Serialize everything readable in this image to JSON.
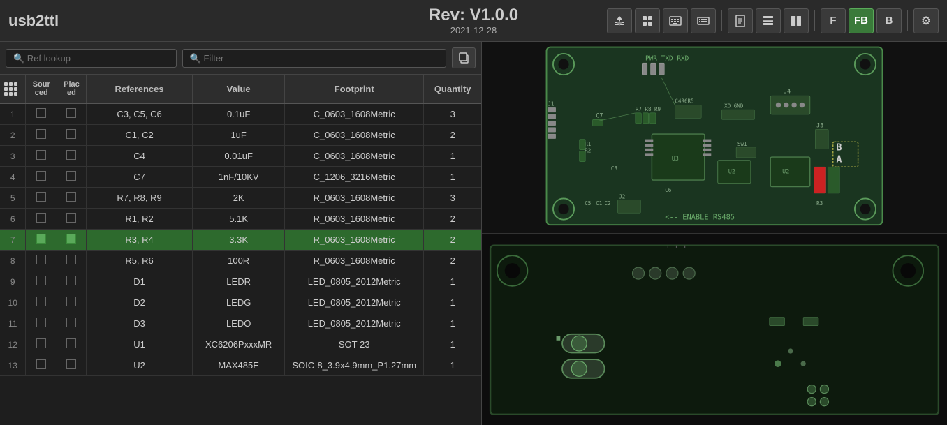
{
  "app": {
    "title": "usb2ttl",
    "revision": "Rev: V1.0.0",
    "date": "2021-12-28"
  },
  "toolbar": {
    "buttons": [
      {
        "id": "import",
        "label": "⬆",
        "active": false
      },
      {
        "id": "grid",
        "label": "⊞",
        "active": false
      },
      {
        "id": "keyboard1",
        "label": "⌨",
        "active": false
      },
      {
        "id": "keyboard2",
        "label": "⌨",
        "active": false
      },
      {
        "id": "doc",
        "label": "📄",
        "active": false
      },
      {
        "id": "list1",
        "label": "☰",
        "active": false
      },
      {
        "id": "list2",
        "label": "☰",
        "active": false
      },
      {
        "id": "F",
        "label": "F",
        "active": false
      },
      {
        "id": "FB",
        "label": "FB",
        "active": true
      },
      {
        "id": "B",
        "label": "B",
        "active": false
      },
      {
        "id": "gear",
        "label": "⚙",
        "active": false
      }
    ]
  },
  "search": {
    "ref_placeholder": "🔍 Ref lookup",
    "filter_placeholder": "🔍 Filter"
  },
  "table": {
    "headers": [
      "",
      "Sourced",
      "Placed",
      "References",
      "Value",
      "Footprint",
      "Quantity"
    ],
    "rows": [
      {
        "num": 1,
        "sourced": false,
        "placed": false,
        "refs": "C3, C5, C6",
        "value": "0.1uF",
        "footprint": "C_0603_1608Metric",
        "qty": 3,
        "highlight": false
      },
      {
        "num": 2,
        "sourced": false,
        "placed": false,
        "refs": "C1, C2",
        "value": "1uF",
        "footprint": "C_0603_1608Metric",
        "qty": 2,
        "highlight": false
      },
      {
        "num": 3,
        "sourced": false,
        "placed": false,
        "refs": "C4",
        "value": "0.01uF",
        "footprint": "C_0603_1608Metric",
        "qty": 1,
        "highlight": false
      },
      {
        "num": 4,
        "sourced": false,
        "placed": false,
        "refs": "C7",
        "value": "1nF/10KV",
        "footprint": "C_1206_3216Metric",
        "qty": 1,
        "highlight": false
      },
      {
        "num": 5,
        "sourced": false,
        "placed": false,
        "refs": "R7, R8, R9",
        "value": "2K",
        "footprint": "R_0603_1608Metric",
        "qty": 3,
        "highlight": false
      },
      {
        "num": 6,
        "sourced": false,
        "placed": false,
        "refs": "R1, R2",
        "value": "5.1K",
        "footprint": "R_0603_1608Metric",
        "qty": 2,
        "highlight": false
      },
      {
        "num": 7,
        "sourced": true,
        "placed": true,
        "refs": "R3, R4",
        "value": "3.3K",
        "footprint": "R_0603_1608Metric",
        "qty": 2,
        "highlight": true
      },
      {
        "num": 8,
        "sourced": false,
        "placed": false,
        "refs": "R5, R6",
        "value": "100R",
        "footprint": "R_0603_1608Metric",
        "qty": 2,
        "highlight": false
      },
      {
        "num": 9,
        "sourced": false,
        "placed": false,
        "refs": "D1",
        "value": "LEDR",
        "footprint": "LED_0805_2012Metric",
        "qty": 1,
        "highlight": false
      },
      {
        "num": 10,
        "sourced": false,
        "placed": false,
        "refs": "D2",
        "value": "LEDG",
        "footprint": "LED_0805_2012Metric",
        "qty": 1,
        "highlight": false
      },
      {
        "num": 11,
        "sourced": false,
        "placed": false,
        "refs": "D3",
        "value": "LEDO",
        "footprint": "LED_0805_2012Metric",
        "qty": 1,
        "highlight": false
      },
      {
        "num": 12,
        "sourced": false,
        "placed": false,
        "refs": "U1",
        "value": "XC6206PxxxMR",
        "footprint": "SOT-23",
        "qty": 1,
        "highlight": false
      },
      {
        "num": 13,
        "sourced": false,
        "placed": false,
        "refs": "U2",
        "value": "MAX485E",
        "footprint": "SOIC-8_3.9x4.9mm_P1.27mm",
        "qty": 1,
        "highlight": false
      }
    ]
  },
  "pcb": {
    "enable_label": "<-- ENABLE RS485",
    "top_labels": [
      "PWR",
      "TXD",
      "RXD"
    ],
    "b_label": "B",
    "a_label": "A"
  }
}
